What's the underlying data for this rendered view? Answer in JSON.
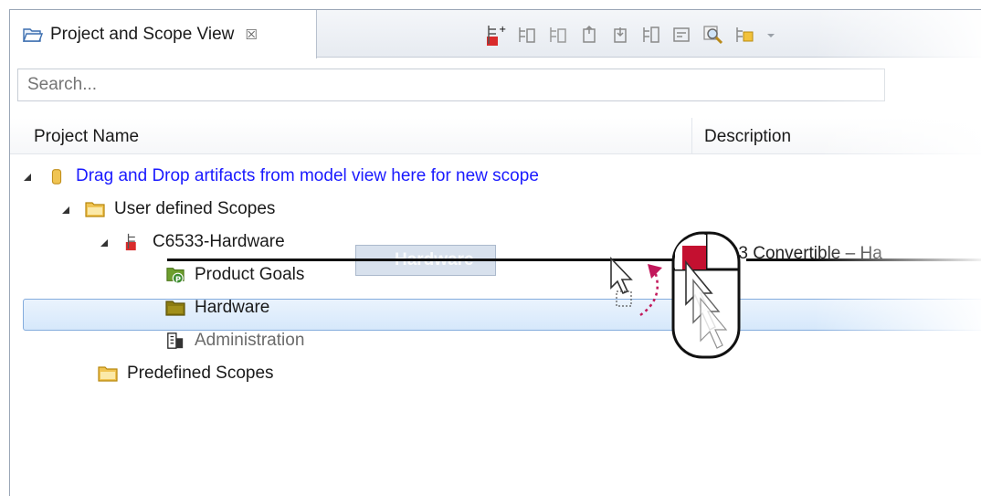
{
  "tab": {
    "title": "Project and Scope View",
    "close_glyph": "☒"
  },
  "toolbar": {
    "icons": [
      "new-scope-icon",
      "add-icon",
      "remove-icon",
      "move-up-icon",
      "move-down-icon",
      "copy-icon",
      "filter-icon",
      "search-scope-icon",
      "scope-wizard-icon",
      "dropdown-icon"
    ]
  },
  "search": {
    "value": "Search..."
  },
  "columns": {
    "name": "Project Name",
    "description": "Description"
  },
  "tree": {
    "root": "Drag and Drop artifacts from model view here for new scope",
    "user_defined": "User defined Scopes",
    "project": "C6533-Hardware",
    "project_desc": "C6533 Convertible – Ha",
    "product_goals": "Product Goals",
    "hardware": "Hardware",
    "administration": "Administration",
    "predefined": "Predefined Scopes",
    "drag_ghost": "Hardware"
  },
  "colors": {
    "link": "#1a1aff",
    "selection": "#d6e8fb",
    "folder": "#e8b84a"
  }
}
